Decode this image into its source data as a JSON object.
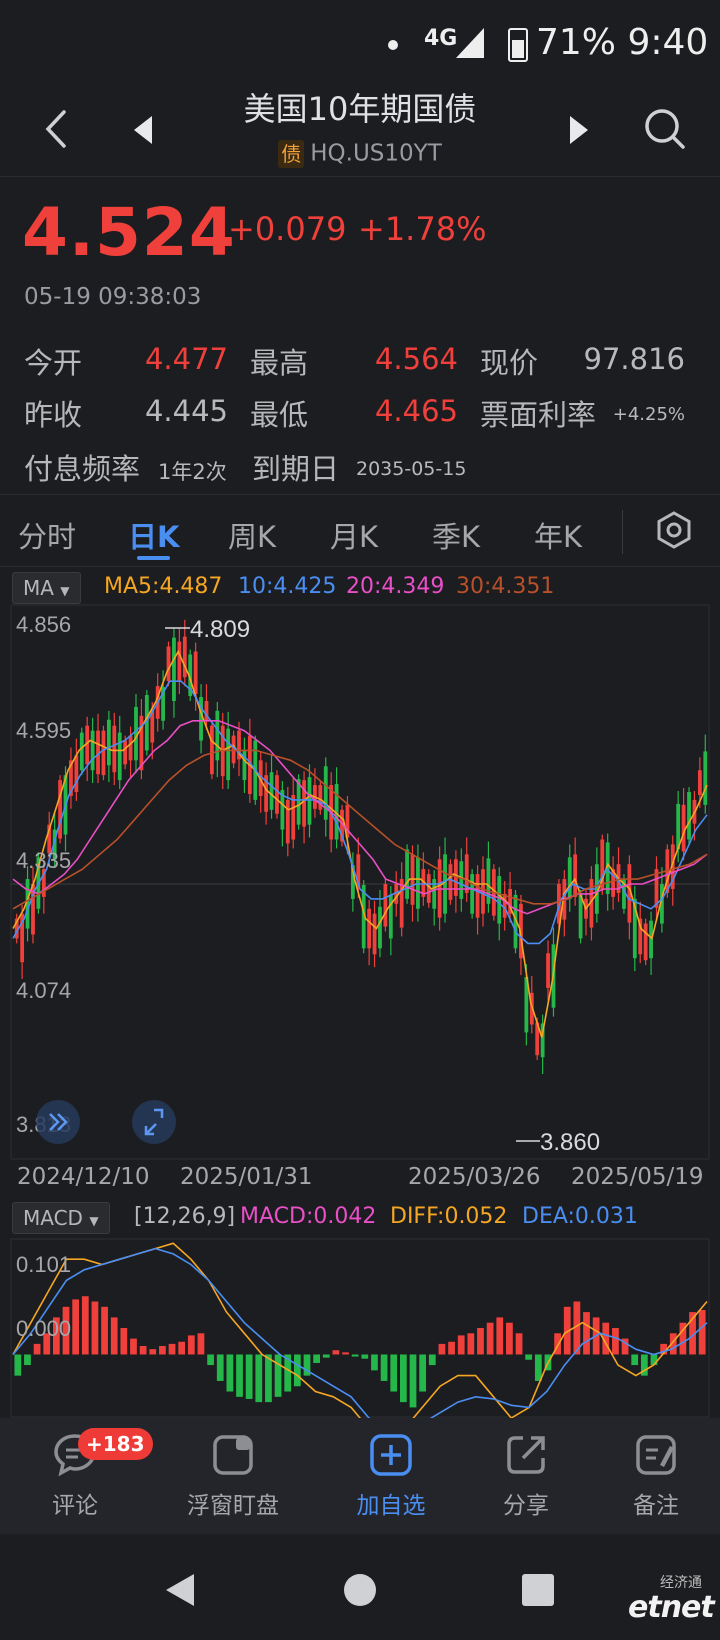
{
  "status_bar": {
    "network": "4G",
    "battery": "71%",
    "time": "9:40"
  },
  "header": {
    "title": "美国10年期国债",
    "type_tag": "债",
    "code": "HQ.US10YT"
  },
  "quote": {
    "price": "4.524",
    "change": "+0.079",
    "change_pct": "+1.78%",
    "datetime": "05-19 09:38:03",
    "open_label": "今开",
    "open": "4.477",
    "high_label": "最高",
    "high": "4.564",
    "cur_label": "现价",
    "cur": "97.816",
    "prev_label": "昨收",
    "prev": "4.445",
    "low_label": "最低",
    "low": "4.465",
    "coupon_label": "票面利率",
    "coupon": "+4.25%",
    "freq_label": "付息频率",
    "freq": "1年2次",
    "maturity_label": "到期日",
    "maturity": "2035-05-15"
  },
  "tabs": [
    {
      "label": "分时",
      "active": false
    },
    {
      "label": "日K",
      "active": true
    },
    {
      "label": "周K",
      "active": false
    },
    {
      "label": "月K",
      "active": false
    },
    {
      "label": "季K",
      "active": false
    },
    {
      "label": "年K",
      "active": false
    }
  ],
  "ma_row": {
    "select": "MA",
    "ma5": "MA5:4.487",
    "ma10": "10:4.425",
    "ma20": "20:4.349",
    "ma30": "30:4.351"
  },
  "macd_row": {
    "select": "MACD",
    "params": "[12,26,9]",
    "macd": "MACD:0.042",
    "diff": "DIFF:0.052",
    "dea": "DEA:0.031"
  },
  "colors": {
    "up": "#f0403b",
    "down": "#25b74a",
    "ma5": "#f5a623",
    "ma10": "#4b8ef2",
    "ma20": "#e94fc7",
    "ma30": "#b8502a",
    "accent": "#4b8ef2"
  },
  "chart_data": [
    {
      "type": "candlestick",
      "y_ticks": [
        "4.856",
        "4.595",
        "4.335",
        "4.074",
        "3.813"
      ],
      "x_ticks": [
        "2024/12/10",
        "2025/01/31",
        "2025/03/26",
        "2025/05/19"
      ],
      "ylim": [
        3.813,
        4.856
      ],
      "max_label": "4.809",
      "min_label": "3.860",
      "series": [
        {
          "name": "MA5",
          "values": [
            4.2,
            4.24,
            4.3,
            4.38,
            4.45,
            4.52,
            4.56,
            4.58,
            4.57,
            4.56,
            4.56,
            4.58,
            4.62,
            4.66,
            4.72,
            4.76,
            4.71,
            4.64,
            4.58,
            4.56,
            4.57,
            4.54,
            4.52,
            4.48,
            4.46,
            4.44,
            4.45,
            4.47,
            4.46,
            4.44,
            4.42,
            4.3,
            4.22,
            4.2,
            4.24,
            4.27,
            4.3,
            4.3,
            4.28,
            4.29,
            4.31,
            4.3,
            4.29,
            4.29,
            4.27,
            4.25,
            4.2,
            4.05,
            3.98,
            4.1,
            4.27,
            4.3,
            4.24,
            4.27,
            4.33,
            4.3,
            4.28,
            4.2,
            4.18,
            4.27,
            4.34,
            4.4,
            4.44,
            4.49
          ]
        },
        {
          "name": "MA10",
          "values": [
            4.18,
            4.22,
            4.28,
            4.32,
            4.4,
            4.47,
            4.51,
            4.54,
            4.56,
            4.57,
            4.58,
            4.6,
            4.62,
            4.66,
            4.7,
            4.7,
            4.68,
            4.64,
            4.61,
            4.58,
            4.56,
            4.54,
            4.51,
            4.49,
            4.47,
            4.46,
            4.46,
            4.46,
            4.45,
            4.41,
            4.35,
            4.28,
            4.26,
            4.26,
            4.27,
            4.28,
            4.29,
            4.29,
            4.29,
            4.3,
            4.29,
            4.28,
            4.27,
            4.26,
            4.24,
            4.19,
            4.17,
            4.17,
            4.19,
            4.26,
            4.29,
            4.28,
            4.28,
            4.32,
            4.3,
            4.26,
            4.25,
            4.24,
            4.26,
            4.3,
            4.35,
            4.4,
            4.43
          ]
        },
        {
          "name": "MA20",
          "values": [
            4.3,
            4.28,
            4.27,
            4.29,
            4.31,
            4.34,
            4.38,
            4.42,
            4.46,
            4.5,
            4.53,
            4.56,
            4.58,
            4.61,
            4.62,
            4.62,
            4.62,
            4.61,
            4.6,
            4.58,
            4.56,
            4.53,
            4.5,
            4.47,
            4.45,
            4.43,
            4.4,
            4.37,
            4.34,
            4.3,
            4.29,
            4.28,
            4.27,
            4.28,
            4.28,
            4.28,
            4.28,
            4.27,
            4.26,
            4.24,
            4.23,
            4.24,
            4.25,
            4.26,
            4.27,
            4.27,
            4.28,
            4.28,
            4.29,
            4.29,
            4.3,
            4.31,
            4.32,
            4.33,
            4.35
          ]
        },
        {
          "name": "MA30",
          "values": [
            4.24,
            4.26,
            4.28,
            4.3,
            4.32,
            4.35,
            4.38,
            4.42,
            4.46,
            4.5,
            4.53,
            4.55,
            4.56,
            4.56,
            4.56,
            4.55,
            4.54,
            4.52,
            4.49,
            4.46,
            4.43,
            4.4,
            4.37,
            4.35,
            4.33,
            4.31,
            4.3,
            4.28,
            4.27,
            4.26,
            4.25,
            4.25,
            4.26,
            4.28,
            4.29,
            4.3,
            4.3,
            4.31,
            4.32,
            4.33,
            4.35
          ]
        }
      ]
    },
    {
      "type": "bar",
      "y_ticks": [
        "0.101",
        "0.000"
      ],
      "ylim": [
        -0.06,
        0.11
      ],
      "series": [
        {
          "name": "MACD",
          "values": [
            -0.02,
            -0.01,
            0.01,
            0.02,
            0.035,
            0.045,
            0.052,
            0.055,
            0.05,
            0.045,
            0.035,
            0.025,
            0.015,
            0.008,
            0.005,
            0.008,
            0.01,
            0.012,
            0.018,
            0.02,
            -0.01,
            -0.025,
            -0.035,
            -0.04,
            -0.042,
            -0.045,
            -0.045,
            -0.04,
            -0.035,
            -0.03,
            -0.02,
            -0.008,
            -0.003,
            0.004,
            0.002,
            -0.002,
            -0.004,
            -0.015,
            -0.025,
            -0.035,
            -0.045,
            -0.05,
            -0.035,
            -0.01,
            0.01,
            0.012,
            0.018,
            0.02,
            0.025,
            0.03,
            0.035,
            0.03,
            0.02,
            -0.005,
            -0.025,
            -0.015,
            0.02,
            0.045,
            0.05,
            0.04,
            0.035,
            0.03,
            0.025,
            0.015,
            -0.01,
            -0.02,
            -0.01,
            0.01,
            0.02,
            0.03,
            0.04,
            0.042
          ]
        },
        {
          "name": "DIFF",
          "values": [
            0.0,
            0.03,
            0.06,
            0.09,
            0.09,
            0.085,
            0.09,
            0.095,
            0.1,
            0.105,
            0.09,
            0.07,
            0.04,
            0.02,
            0.0,
            -0.01,
            -0.02,
            -0.035,
            -0.04,
            -0.05,
            -0.07,
            -0.075,
            -0.07,
            -0.05,
            -0.03,
            -0.02,
            -0.02,
            -0.04,
            -0.06,
            -0.05,
            -0.01,
            0.02,
            0.03,
            0.02,
            -0.01,
            -0.02,
            -0.01,
            0.01,
            0.03,
            0.05
          ]
        },
        {
          "name": "DEA",
          "values": [
            0.0,
            0.02,
            0.045,
            0.07,
            0.08,
            0.085,
            0.09,
            0.095,
            0.1,
            0.095,
            0.085,
            0.07,
            0.05,
            0.03,
            0.015,
            0.0,
            -0.01,
            -0.02,
            -0.03,
            -0.04,
            -0.06,
            -0.068,
            -0.07,
            -0.065,
            -0.055,
            -0.045,
            -0.04,
            -0.042,
            -0.048,
            -0.05,
            -0.035,
            -0.01,
            0.01,
            0.02,
            0.015,
            0.005,
            0.0,
            0.005,
            0.015,
            0.03
          ]
        }
      ]
    }
  ],
  "bottom_bar": {
    "badge": "+183",
    "items": [
      {
        "label": "评论",
        "icon": "comment-icon"
      },
      {
        "label": "浮窗盯盘",
        "icon": "float-window-icon"
      },
      {
        "label": "加自选",
        "icon": "add-watchlist-icon"
      },
      {
        "label": "分享",
        "icon": "share-icon"
      },
      {
        "label": "备注",
        "icon": "note-icon"
      }
    ]
  },
  "watermark": {
    "cn": "经济通",
    "en": "etnet"
  }
}
